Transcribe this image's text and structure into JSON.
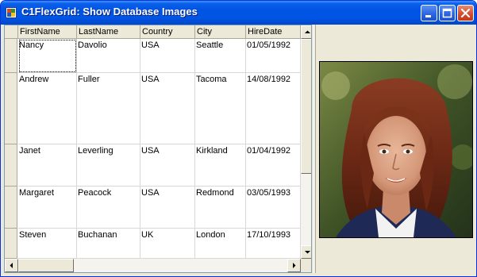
{
  "window": {
    "title": "C1FlexGrid: Show Database Images",
    "controls": [
      "minimize",
      "maximize",
      "close"
    ]
  },
  "grid": {
    "columns": [
      "FirstName",
      "LastName",
      "Country",
      "City",
      "HireDate"
    ],
    "rows": [
      [
        "Nancy",
        "Davolio",
        "USA",
        "Seattle",
        "01/05/1992"
      ],
      [
        "Andrew",
        "Fuller",
        "USA",
        "Tacoma",
        "14/08/1992"
      ],
      [
        "Janet",
        "Leverling",
        "USA",
        "Kirkland",
        "01/04/1992"
      ],
      [
        "Margaret",
        "Peacock",
        "USA",
        "Redmond",
        "03/05/1993"
      ],
      [
        "Steven",
        "Buchanan",
        "UK",
        "London",
        "17/10/1993"
      ]
    ]
  },
  "photo": {
    "icon": "portrait-photo"
  },
  "colors": {
    "titlebar": "#0054e3",
    "window_bg": "#ece9d8",
    "close_button": "#d2492b"
  }
}
